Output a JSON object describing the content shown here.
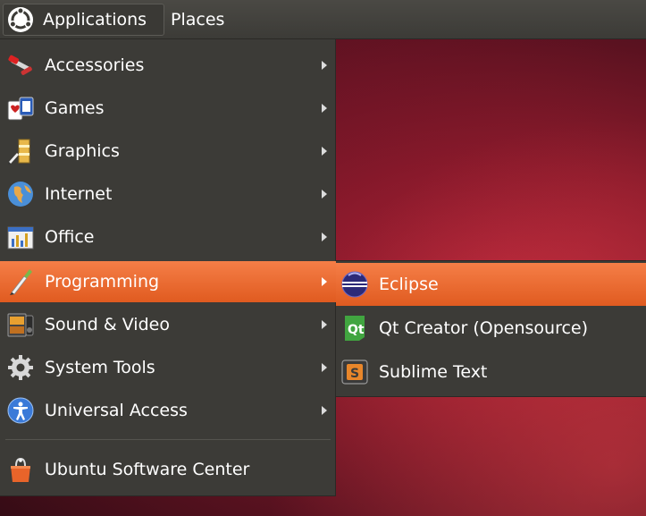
{
  "panel": {
    "applications_label": "Applications",
    "places_label": "Places"
  },
  "menu": {
    "items": [
      {
        "label": "Accessories",
        "icon": "accessories-icon",
        "has_submenu": true
      },
      {
        "label": "Games",
        "icon": "games-icon",
        "has_submenu": true
      },
      {
        "label": "Graphics",
        "icon": "graphics-icon",
        "has_submenu": true
      },
      {
        "label": "Internet",
        "icon": "internet-icon",
        "has_submenu": true
      },
      {
        "label": "Office",
        "icon": "office-icon",
        "has_submenu": true
      },
      {
        "label": "Programming",
        "icon": "programming-icon",
        "has_submenu": true,
        "active": true
      },
      {
        "label": "Sound & Video",
        "icon": "sound-video-icon",
        "has_submenu": true
      },
      {
        "label": "System Tools",
        "icon": "system-tools-icon",
        "has_submenu": true
      },
      {
        "label": "Universal Access",
        "icon": "universal-access-icon",
        "has_submenu": true
      }
    ],
    "footer_item": {
      "label": "Ubuntu Software Center",
      "icon": "software-center-icon"
    }
  },
  "submenu": {
    "items": [
      {
        "label": "Eclipse",
        "icon": "eclipse-icon",
        "active": true
      },
      {
        "label": "Qt Creator (Opensource)",
        "icon": "qt-creator-icon"
      },
      {
        "label": "Sublime Text",
        "icon": "sublime-text-icon"
      }
    ]
  },
  "colors": {
    "menu_bg": "#3c3b37",
    "highlight": "#e9672e",
    "wallpaper": "#8e1b2c"
  }
}
